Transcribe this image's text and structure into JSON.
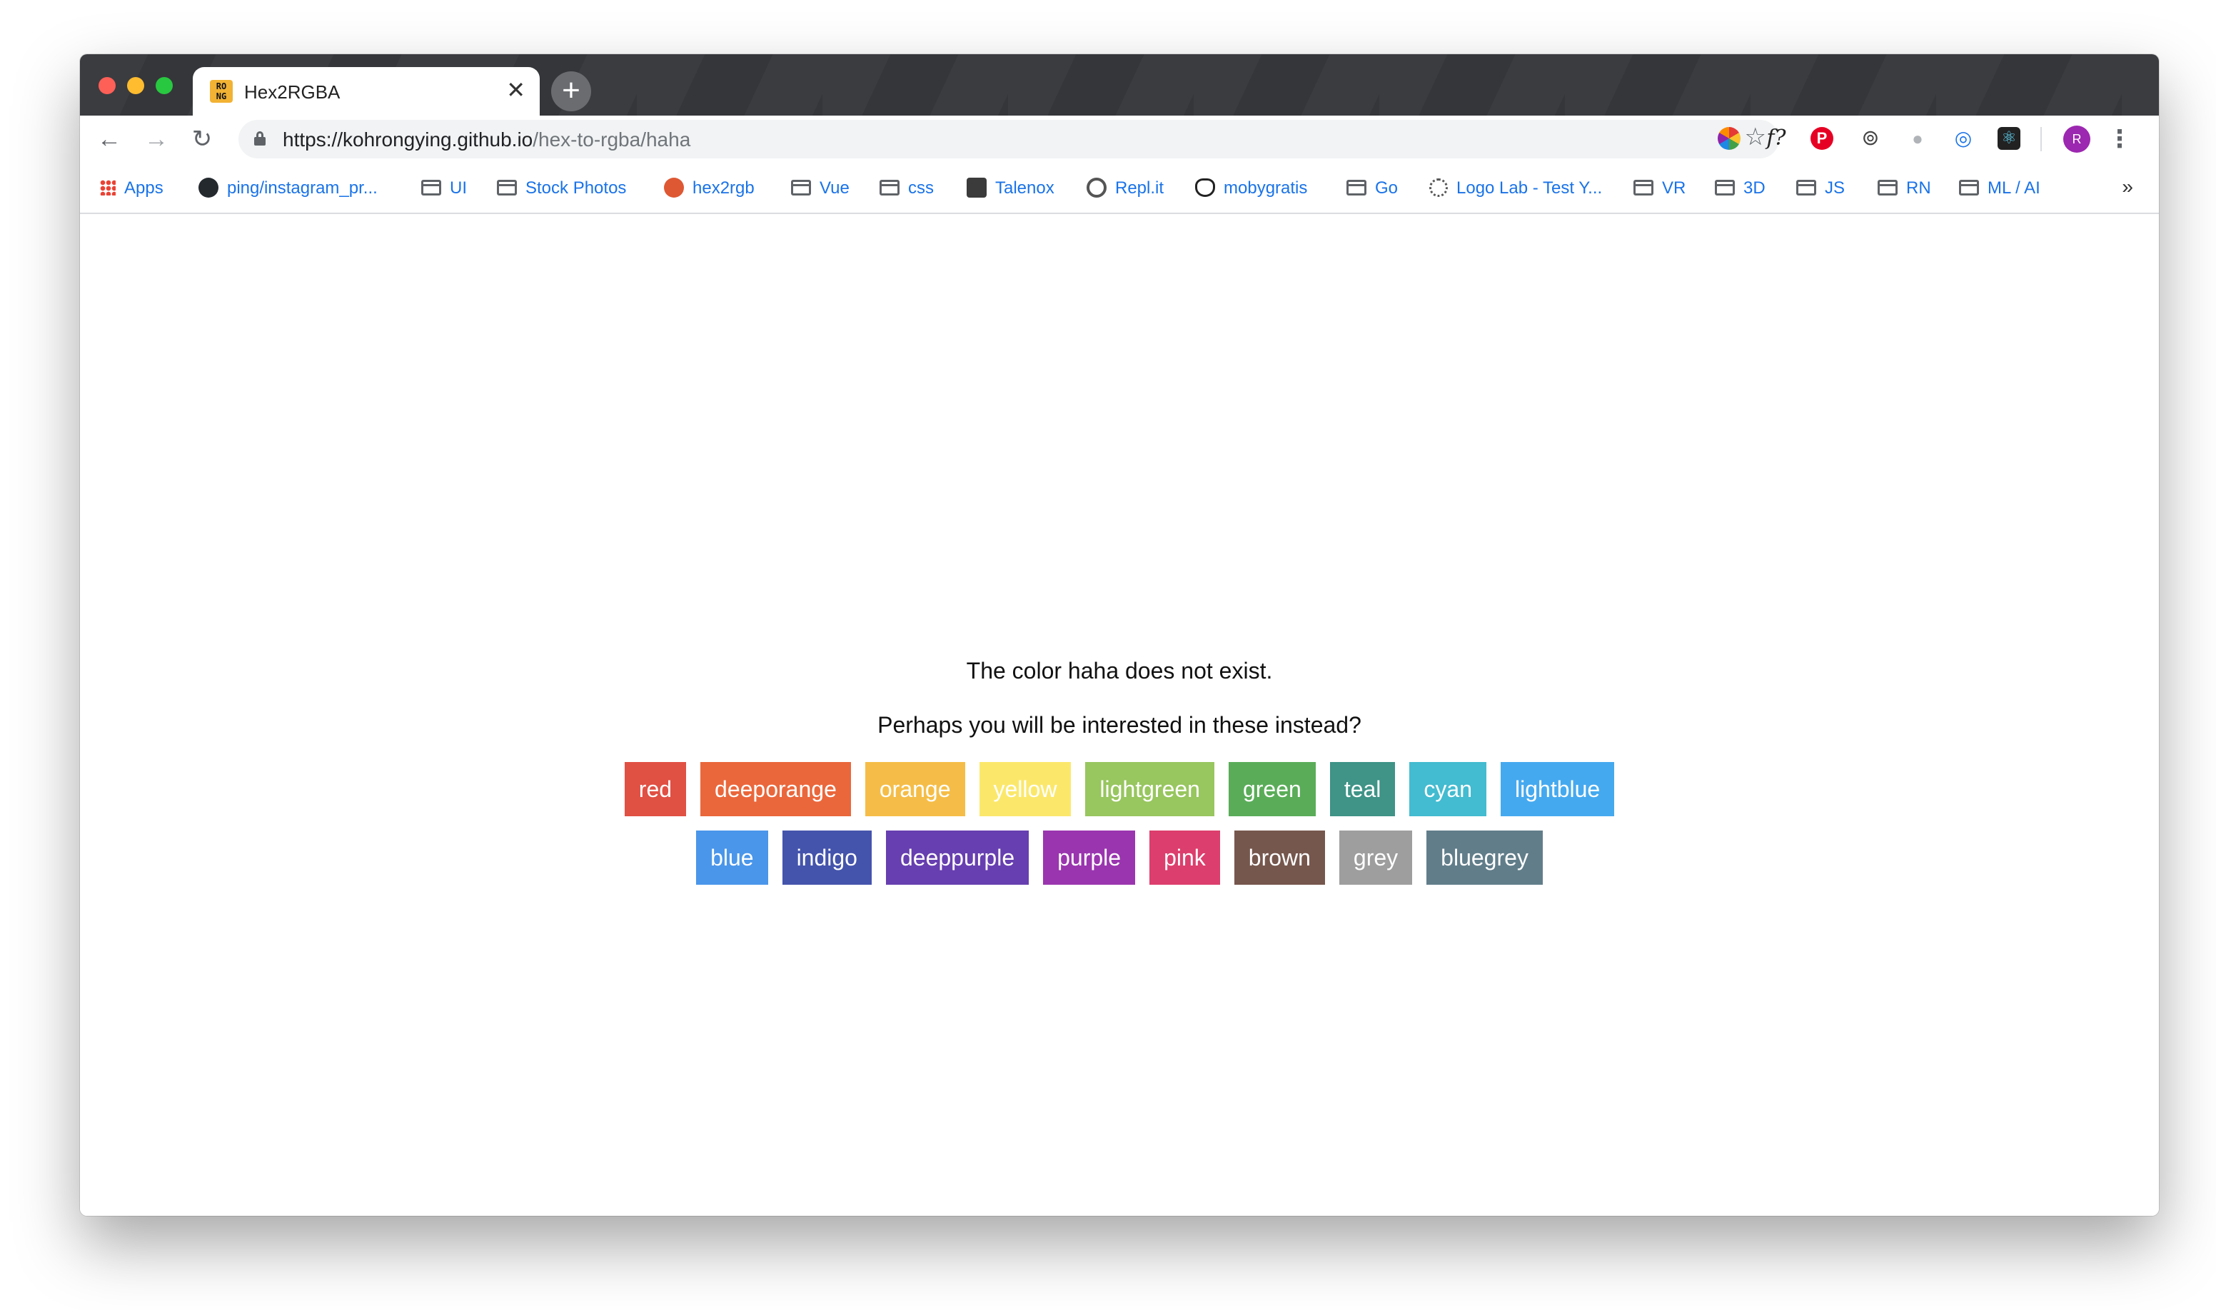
{
  "browser": {
    "tab": {
      "favicon_text": "RO NG",
      "title": "Hex2RGBA"
    },
    "new_tab_symbol": "+",
    "close_symbol": "✕",
    "nav": {
      "back": "←",
      "forward": "→",
      "reload": "↻"
    },
    "address": {
      "host_part": "https://kohrongying.github.io",
      "path_part": "/hex-to-rgba/haha"
    },
    "avatar_initial": "R",
    "bookmarks": [
      {
        "label": "Apps",
        "icon": "apps-grid-icon"
      },
      {
        "label": "ping/instagram_pr...",
        "icon": "github-icon"
      },
      {
        "label": "UI",
        "icon": "folder-icon"
      },
      {
        "label": "Stock Photos",
        "icon": "folder-icon"
      },
      {
        "label": "hex2rgb",
        "icon": "duckduckgo-icon"
      },
      {
        "label": "Vue",
        "icon": "folder-icon"
      },
      {
        "label": "css",
        "icon": "folder-icon"
      },
      {
        "label": "Talenox",
        "icon": "talenox-icon"
      },
      {
        "label": "Repl.it",
        "icon": "replit-icon"
      },
      {
        "label": "mobygratis",
        "icon": "moby-icon"
      },
      {
        "label": "Go",
        "icon": "folder-icon"
      },
      {
        "label": "Logo Lab - Test Y...",
        "icon": "logo-lab-icon"
      },
      {
        "label": "VR",
        "icon": "folder-icon"
      },
      {
        "label": "3D",
        "icon": "folder-icon"
      },
      {
        "label": "JS",
        "icon": "folder-icon"
      },
      {
        "label": "RN",
        "icon": "folder-icon"
      },
      {
        "label": "ML / AI",
        "icon": "folder-icon"
      }
    ],
    "bookmarks_overflow": "»"
  },
  "page": {
    "message": "The color haha does not exist.",
    "suggestion_prompt": "Perhaps you will be interested in these instead?",
    "colors_row1": [
      {
        "name": "red",
        "hex": "#e05043"
      },
      {
        "name": "deeporange",
        "hex": "#ea673b"
      },
      {
        "name": "orange",
        "hex": "#f5bd47"
      },
      {
        "name": "yellow",
        "hex": "#fbe86b"
      },
      {
        "name": "lightgreen",
        "hex": "#98c65f"
      },
      {
        "name": "green",
        "hex": "#5aac59"
      },
      {
        "name": "teal",
        "hex": "#3f9387"
      },
      {
        "name": "cyan",
        "hex": "#43bbd0"
      },
      {
        "name": "lightblue",
        "hex": "#45a9ef"
      }
    ],
    "colors_row2": [
      {
        "name": "blue",
        "hex": "#4a96ea"
      },
      {
        "name": "indigo",
        "hex": "#4454ac"
      },
      {
        "name": "deeppurple",
        "hex": "#673fb0"
      },
      {
        "name": "purple",
        "hex": "#9a35af"
      },
      {
        "name": "pink",
        "hex": "#dc3e6d"
      },
      {
        "name": "brown",
        "hex": "#76574d"
      },
      {
        "name": "grey",
        "hex": "#9e9e9e"
      },
      {
        "name": "bluegrey",
        "hex": "#617d8a"
      }
    ]
  }
}
